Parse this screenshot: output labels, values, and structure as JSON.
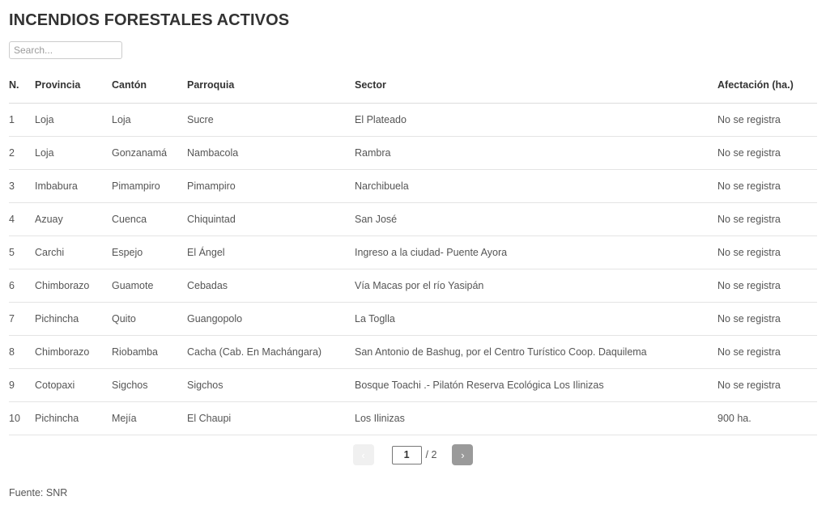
{
  "page": {
    "title": "INCENDIOS FORESTALES ACTIVOS",
    "source_note": "Fuente: SNR"
  },
  "search": {
    "placeholder": "Search...",
    "value": ""
  },
  "table": {
    "columns": [
      "N.",
      "Provincia",
      "Cantón",
      "Parroquia",
      "Sector",
      "Afectación (ha.)"
    ],
    "rows": [
      {
        "n": "1",
        "provincia": "Loja",
        "canton": "Loja",
        "parroquia": "Sucre",
        "sector": "El Plateado",
        "afectacion": "No se registra"
      },
      {
        "n": "2",
        "provincia": "Loja",
        "canton": "Gonzanamá",
        "parroquia": "Nambacola",
        "sector": "Rambra",
        "afectacion": "No se registra"
      },
      {
        "n": "3",
        "provincia": "Imbabura",
        "canton": "Pimampiro",
        "parroquia": "Pimampiro",
        "sector": "Narchibuela",
        "afectacion": "No se registra"
      },
      {
        "n": "4",
        "provincia": "Azuay",
        "canton": "Cuenca",
        "parroquia": "Chiquintad",
        "sector": "San José",
        "afectacion": "No se registra"
      },
      {
        "n": "5",
        "provincia": "Carchi",
        "canton": "Espejo",
        "parroquia": "El Ángel",
        "sector": "Ingreso a la ciudad- Puente Ayora",
        "afectacion": "No se registra"
      },
      {
        "n": "6",
        "provincia": "Chimborazo",
        "canton": "Guamote",
        "parroquia": "Cebadas",
        "sector": "Vía Macas por el río Yasipán",
        "afectacion": "No se registra"
      },
      {
        "n": "7",
        "provincia": "Pichincha",
        "canton": "Quito",
        "parroquia": "Guangopolo",
        "sector": "La Toglla",
        "afectacion": "No se registra"
      },
      {
        "n": "8",
        "provincia": "Chimborazo",
        "canton": "Riobamba",
        "parroquia": "Cacha (Cab. En Machángara)",
        "sector": "San Antonio de Bashug, por el Centro Turístico Coop. Daquilema",
        "afectacion": "No se registra"
      },
      {
        "n": "9",
        "provincia": "Cotopaxi",
        "canton": "Sigchos",
        "parroquia": "Sigchos",
        "sector": "Bosque Toachi .- Pilatón Reserva Ecológica Los Ilinizas",
        "afectacion": "No se registra"
      },
      {
        "n": "10",
        "provincia": "Pichincha",
        "canton": "Mejía",
        "parroquia": "El Chaupi",
        "sector": "Los Ilinizas",
        "afectacion": "900 ha."
      }
    ]
  },
  "pagination": {
    "prev_label": "‹",
    "next_label": "›",
    "current_page": "1",
    "total_label": "/ 2",
    "total_pages": 2
  },
  "colors": {
    "title": "#333333",
    "text": "#555555",
    "row_border": "#e4e4e4",
    "header_border": "#dddddd",
    "next_button": "#9a9a9a",
    "prev_button": "#f0f0f0"
  }
}
